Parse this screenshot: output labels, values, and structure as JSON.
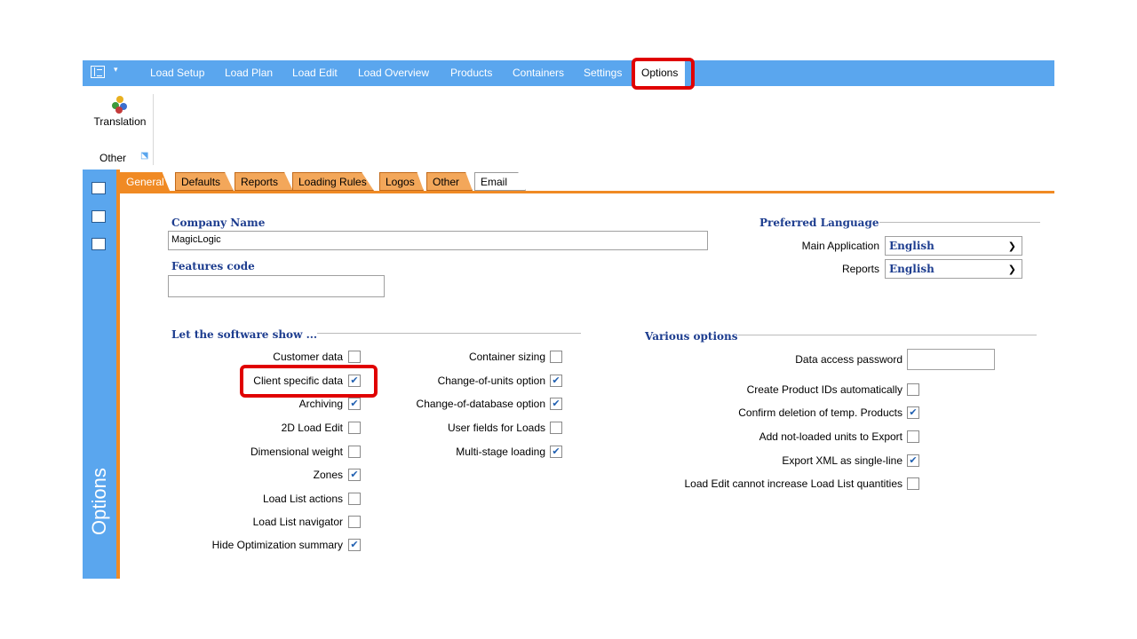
{
  "menu": {
    "items": [
      "Load Setup",
      "Load Plan",
      "Load Edit",
      "Load Overview",
      "Products",
      "Containers",
      "Settings",
      "Options"
    ]
  },
  "ribbon": {
    "translation_label": "Translation",
    "group_label": "Other"
  },
  "sidebar": {
    "label": "Options"
  },
  "tabs": [
    "General",
    "Defaults",
    "Reports",
    "Loading Rules",
    "Logos",
    "Other",
    "Email"
  ],
  "general": {
    "company_name_title": "Company Name",
    "company_name_value": "MagicLogic",
    "features_code_title": "Features code",
    "features_code_value": "",
    "preferred_language_title": "Preferred Language",
    "main_application_label": "Main Application",
    "main_application_value": "English",
    "reports_label": "Reports",
    "reports_value": "English",
    "show_title": "Let the software show ...",
    "show_col1": [
      {
        "label": "Customer data",
        "checked": false
      },
      {
        "label": "Client specific data",
        "checked": true
      },
      {
        "label": "Archiving",
        "checked": true
      },
      {
        "label": "2D Load Edit",
        "checked": false
      },
      {
        "label": "Dimensional weight",
        "checked": false
      },
      {
        "label": "Zones",
        "checked": true
      },
      {
        "label": "Load List actions",
        "checked": false
      },
      {
        "label": "Load List navigator",
        "checked": false
      },
      {
        "label": "Hide Optimization summary",
        "checked": true
      }
    ],
    "show_col2": [
      {
        "label": "Container sizing",
        "checked": false
      },
      {
        "label": "Change-of-units option",
        "checked": true
      },
      {
        "label": "Change-of-database option",
        "checked": true
      },
      {
        "label": "User fields for Loads",
        "checked": false
      },
      {
        "label": "Multi-stage loading",
        "checked": true
      }
    ],
    "various_title": "Various options",
    "data_access_password_label": "Data access password",
    "data_access_password_value": "",
    "various": [
      {
        "label": "Create Product IDs automatically",
        "checked": false
      },
      {
        "label": "Confirm deletion of temp. Products",
        "checked": true
      },
      {
        "label": "Add not-loaded units to Export",
        "checked": false
      },
      {
        "label": "Export XML as single-line",
        "checked": true
      },
      {
        "label": "Load Edit cannot increase Load List quantities",
        "checked": false
      }
    ]
  },
  "colors": {
    "menubar": "#5aa6ee",
    "tab_orange": "#f08a24",
    "section_title": "#1d3d8f",
    "highlight": "#e00000"
  },
  "icons": [
    "app-menu-icon",
    "translation-icon",
    "tree-icon",
    "list-icon",
    "image-icon",
    "dialog-launcher-icon",
    "chevron-down-icon",
    "check-icon"
  ]
}
